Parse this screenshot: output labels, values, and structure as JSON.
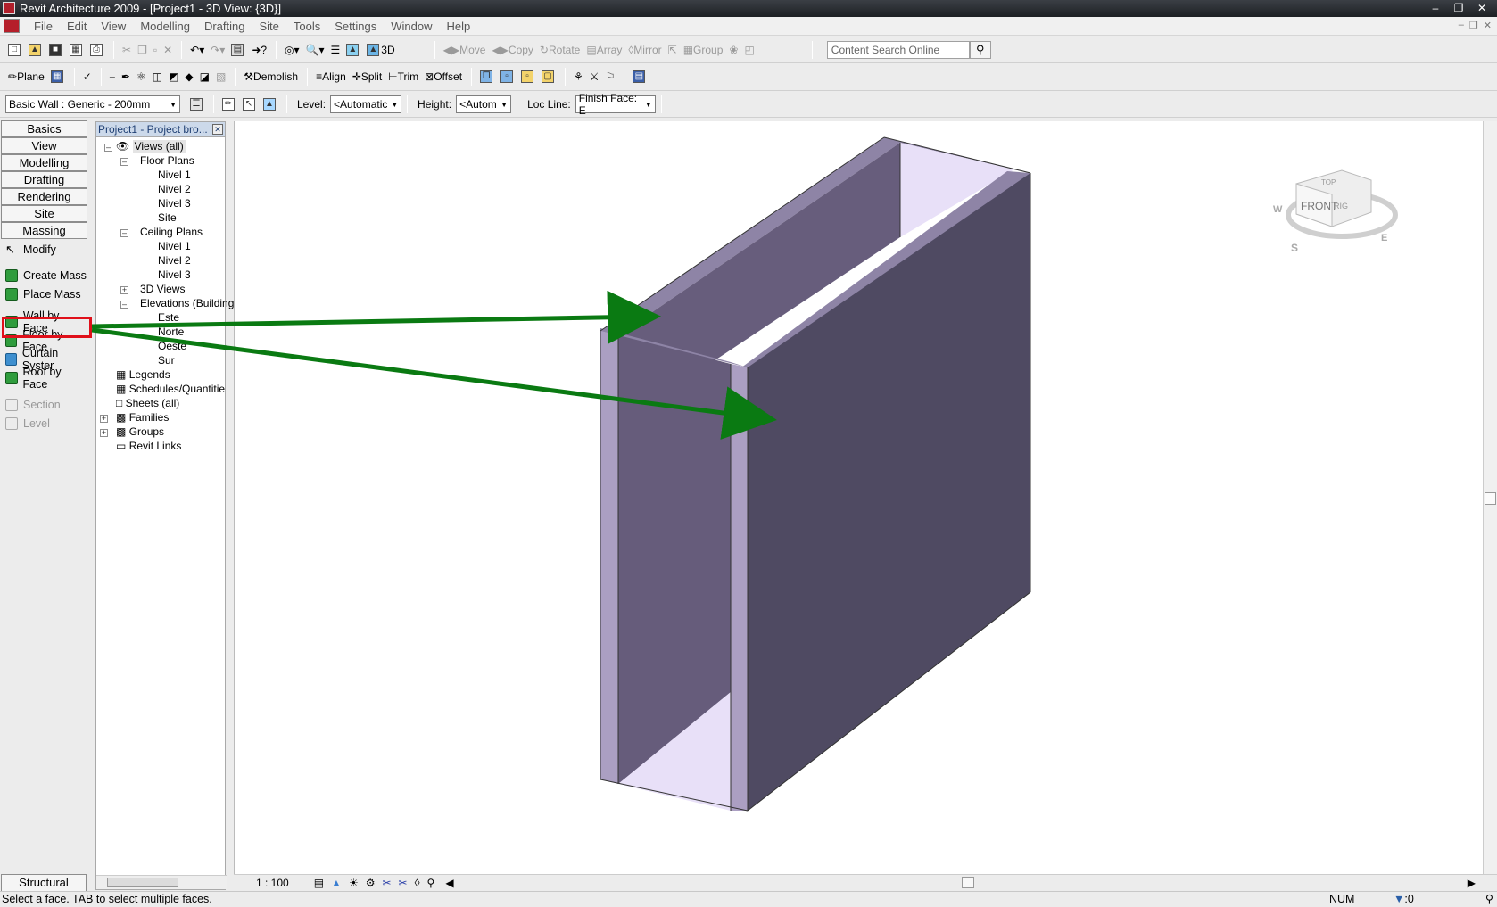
{
  "window": {
    "title": "Revit Architecture 2009 - [Project1 - 3D View: {3D}]"
  },
  "menu": [
    "File",
    "Edit",
    "View",
    "Modelling",
    "Drafting",
    "Site",
    "Tools",
    "Settings",
    "Window",
    "Help"
  ],
  "toolbar1": {
    "view3d_label": "3D",
    "move": "Move",
    "copy": "Copy",
    "rotate": "Rotate",
    "array": "Array",
    "mirror": "Mirror",
    "group": "Group",
    "search_placeholder": "Content Search Online"
  },
  "toolbar2": {
    "plane": "Plane",
    "demolish": "Demolish",
    "align": "Align",
    "split": "Split",
    "trim": "Trim",
    "offset": "Offset"
  },
  "options": {
    "type_selector": "Basic Wall : Generic - 200mm",
    "level_label": "Level:",
    "level_value": "<Automatic",
    "height_label": "Height:",
    "height_value": "<Autom",
    "locline_label": "Loc Line:",
    "locline_value": "Finish Face: E"
  },
  "designbar": {
    "tabs": [
      "Basics",
      "View",
      "Modelling",
      "Drafting",
      "Rendering",
      "Site",
      "Massing"
    ],
    "tools": [
      "Modify",
      "Create Mass",
      "Place Mass",
      "Wall by Face",
      "Floor by Face",
      "Curtain Syster",
      "Roof by Face",
      "Section",
      "Level"
    ],
    "bottom_tab": "Structural"
  },
  "browser": {
    "title": "Project1 - Project bro...",
    "nodes": [
      "Views (all)",
      "Floor Plans",
      "Nivel 1",
      "Nivel 2",
      "Nivel 3",
      "Site",
      "Ceiling Plans",
      "Nivel 1",
      "Nivel 2",
      "Nivel 3",
      "3D Views",
      "Elevations (Building",
      "Este",
      "Norte",
      "Oeste",
      "Sur",
      "Legends",
      "Schedules/Quantitie",
      "Sheets (all)",
      "Families",
      "Groups",
      "Revit Links"
    ]
  },
  "viewcube": {
    "front": "FRONT",
    "right": "RIG",
    "top": "TOP",
    "w": "W",
    "s": "S",
    "e": "E"
  },
  "view_control": {
    "scale": "1 : 100"
  },
  "status": {
    "message": "Select a face.  TAB to select multiple faces.",
    "num": "NUM",
    "filter": ":0"
  },
  "colors": {
    "highlight": "#e0101a",
    "arrow": "#0a7a12",
    "wall_face": "#4f4a62",
    "wall_side": "#6a6080",
    "wall_top": "#8e84a6",
    "wall_inner": "#e8e0f8"
  }
}
